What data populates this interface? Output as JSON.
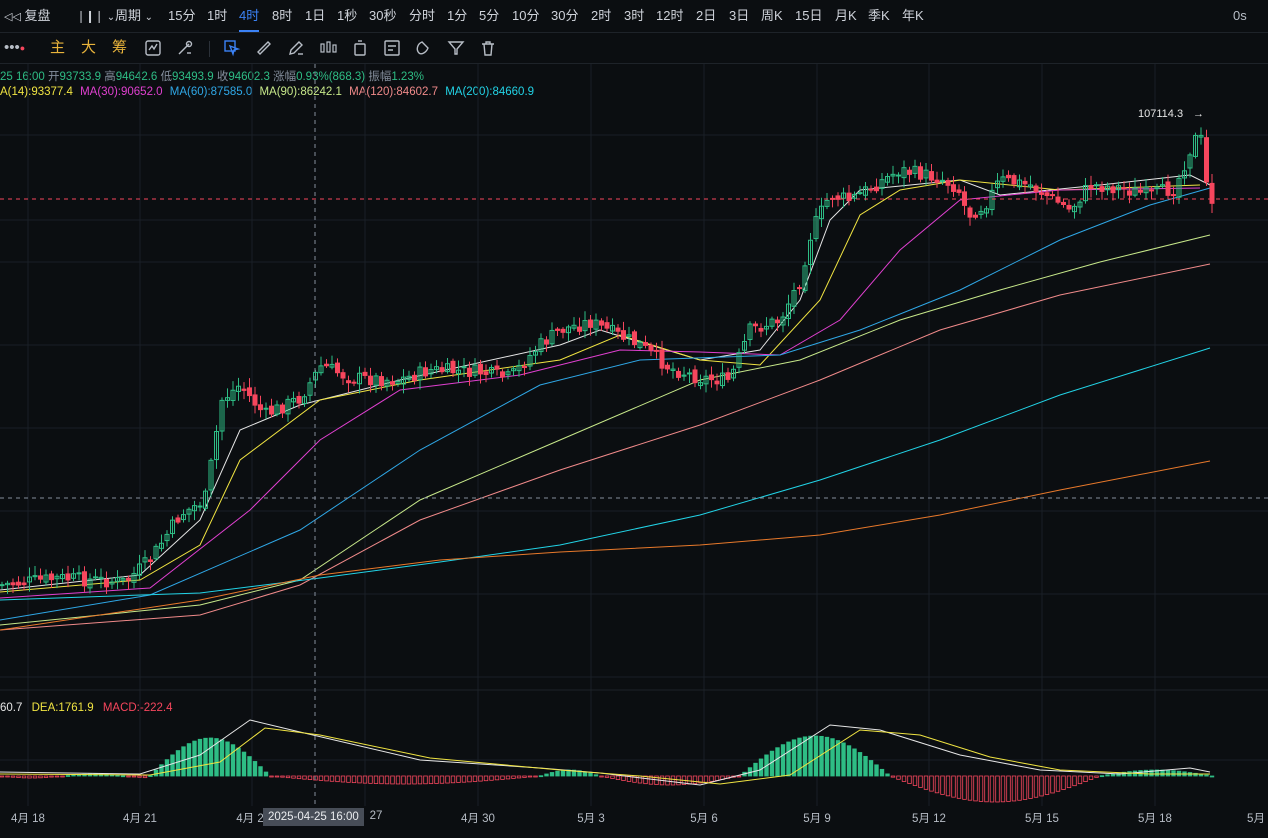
{
  "toolbar_top": {
    "restore_label": "复盘",
    "period_label": "周期",
    "timeframes": [
      "15分",
      "1时",
      "4时",
      "8时",
      "1日",
      "1秒",
      "30秒",
      "分时",
      "1分",
      "5分",
      "10分",
      "30分",
      "2时",
      "3时",
      "12时",
      "2日",
      "3日",
      "周K",
      "15日",
      "月K",
      "季K",
      "年K"
    ],
    "active_timeframe": "4时",
    "countdown": "0s"
  },
  "toolbar_second": {
    "main_label": "主",
    "big_label": "大",
    "chip_label": "筹"
  },
  "ohlc": {
    "date": "25 16:00",
    "open_label": "开",
    "open": "93733.9",
    "high_label": "高",
    "high": "94642.6",
    "low_label": "低",
    "low": "93493.9",
    "close_label": "收",
    "close": "94602.3",
    "change_label": "涨幅",
    "change": "0.93%(868.3)",
    "amp_label": "振幅",
    "amp": "1.23%"
  },
  "ma_legend": [
    {
      "label": "A(14):93377.4",
      "color": "#f0e442"
    },
    {
      "label": "MA(30):90652.0",
      "color": "#e040d0"
    },
    {
      "label": "MA(60):87585.0",
      "color": "#2fa7e6"
    },
    {
      "label": "MA(90):86242.1",
      "color": "#c7e88a"
    },
    {
      "label": "MA(120):84602.7",
      "color": "#f08a8a"
    },
    {
      "label": "MA(200):84660.9",
      "color": "#22d3e6"
    }
  ],
  "macd_legend": {
    "dif": "60.7",
    "dif_color": "#e6e6e6",
    "dea": "DEA:1761.9",
    "dea_color": "#f0e442",
    "macd": "MACD:-222.4",
    "macd_color": "#f6465d"
  },
  "high_marker": "107114.3",
  "x_axis": [
    "4月 18",
    "4月 21",
    "4月 2",
    "27",
    "4月 30",
    "5月 3",
    "5月 6",
    "5月 9",
    "5月 12",
    "5月 15",
    "5月 18",
    "5月"
  ],
  "crosshair_date": "2025-04-25 16:00",
  "colors": {
    "up": "#2ebd85",
    "down": "#f6465d",
    "accent": "#3b82f6",
    "orange": "#e8b33b"
  }
}
